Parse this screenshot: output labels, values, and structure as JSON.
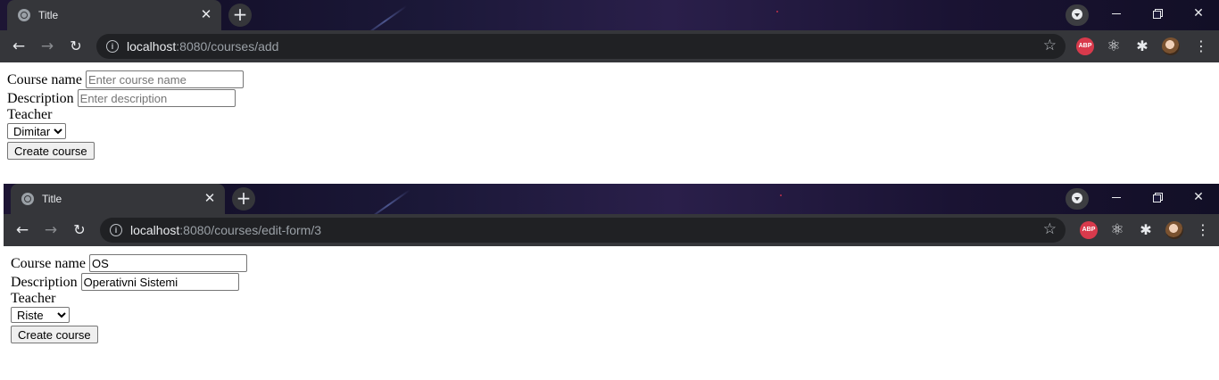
{
  "window_add": {
    "tab_title": "Title",
    "url_host": "localhost",
    "url_path": ":8080/courses/add",
    "extensions": {
      "abp_label": "ABP"
    },
    "form": {
      "course_name_label": "Course name",
      "course_name_placeholder": "Enter course name",
      "course_name_value": "",
      "description_label": "Description",
      "description_placeholder": "Enter description",
      "description_value": "",
      "teacher_label": "Teacher",
      "teacher_selected": "Dimitar",
      "submit_label": "Create course"
    }
  },
  "window_edit": {
    "tab_title": "Title",
    "url_host": "localhost",
    "url_path": ":8080/courses/edit-form/3",
    "extensions": {
      "abp_label": "ABP"
    },
    "form": {
      "course_name_label": "Course name",
      "course_name_value": "OS",
      "description_label": "Description",
      "description_value": "Operativni Sistemi",
      "teacher_label": "Teacher",
      "teacher_selected": "Riste",
      "submit_label": "Create course"
    }
  },
  "colors": {
    "titlebar_bg": "#1b1838",
    "tab_bg": "#35363a",
    "omnibox_bg": "#202124",
    "abp_red": "#d83a4c"
  },
  "icons": [
    "globe-icon",
    "close-icon",
    "plus-icon",
    "profile-dropdown-icon",
    "minimize-icon",
    "restore-icon",
    "close-window-icon",
    "back-icon",
    "forward-icon",
    "reload-icon",
    "info-icon",
    "bookmark-star-icon",
    "adblock-icon",
    "react-devtools-icon",
    "extensions-puzzle-icon",
    "avatar",
    "kebab-menu-icon"
  ]
}
